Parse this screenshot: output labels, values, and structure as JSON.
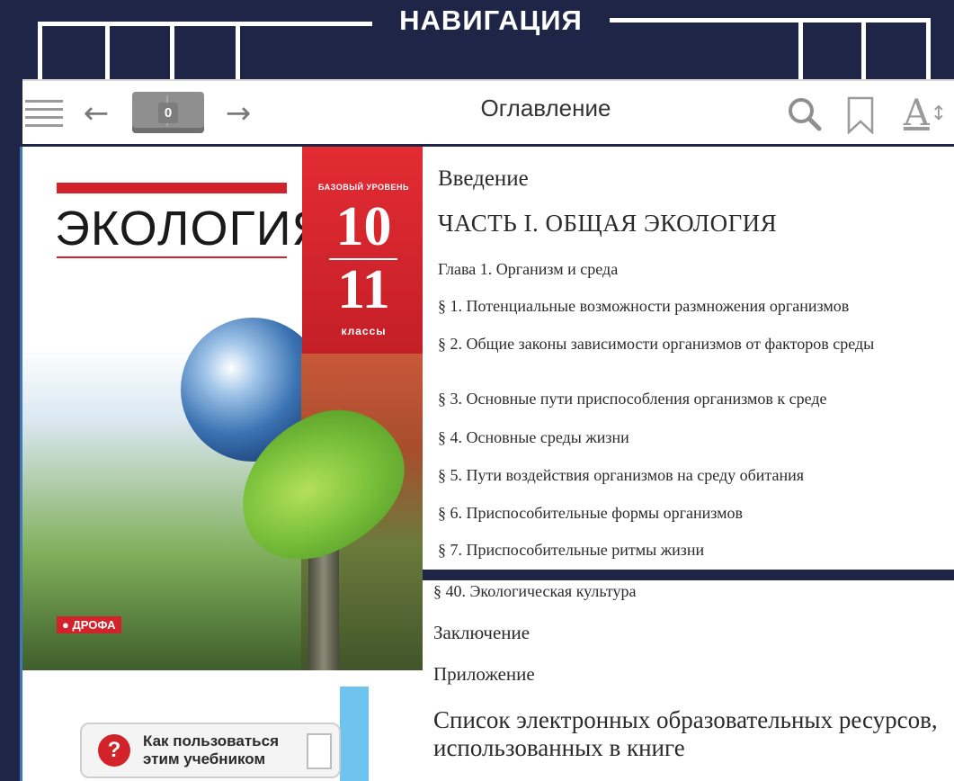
{
  "header": {
    "caption": "НАВИГАЦИЯ"
  },
  "toolbar": {
    "page_counter": "0",
    "title": "Оглавление",
    "back_arrow": "←",
    "forward_arrow": "→",
    "font_letter": "A",
    "font_arrows": "↕",
    "icons": [
      "menu-icon",
      "back-arrow-icon",
      "book-icon",
      "forward-arrow-icon",
      "search-icon",
      "bookmark-icon",
      "font-size-icon"
    ]
  },
  "cover": {
    "title": "ЭКОЛОГИЯ",
    "level": "БАЗОВЫЙ УРОВЕНЬ",
    "grade_from": "10",
    "grade_to": "11",
    "grade_word": "классы",
    "publisher": "● ДРОФА"
  },
  "help": {
    "icon_glyph": "?",
    "label": "Как пользоваться этим учебником"
  },
  "colors": {
    "background": "#1f2547",
    "accent": "#d2232a",
    "help_bar": "#6fc3ef"
  },
  "toc": {
    "items": [
      "Введение",
      "ЧАСТЬ I. ОБЩАЯ ЭКОЛОГИЯ",
      "Глава 1. Организм и среда",
      "§ 1. Потенциальные возможности размножения организмов",
      "§ 2. Общие законы зависимости организмов от факторов среды",
      "§ 3. Основные пути приспособления организмов к среде",
      "§ 4. Основные среды жизни",
      "§ 5. Пути воздействия организмов на среду обитания",
      "§ 6. Приспособительные формы организмов",
      "§ 7. Приспособительные ритмы жизни"
    ],
    "lower_items": [
      "§ 40. Экологическая культура",
      "Заключение",
      "Приложение",
      "Список электронных образовательных ресурсов, использованных в книге"
    ]
  }
}
